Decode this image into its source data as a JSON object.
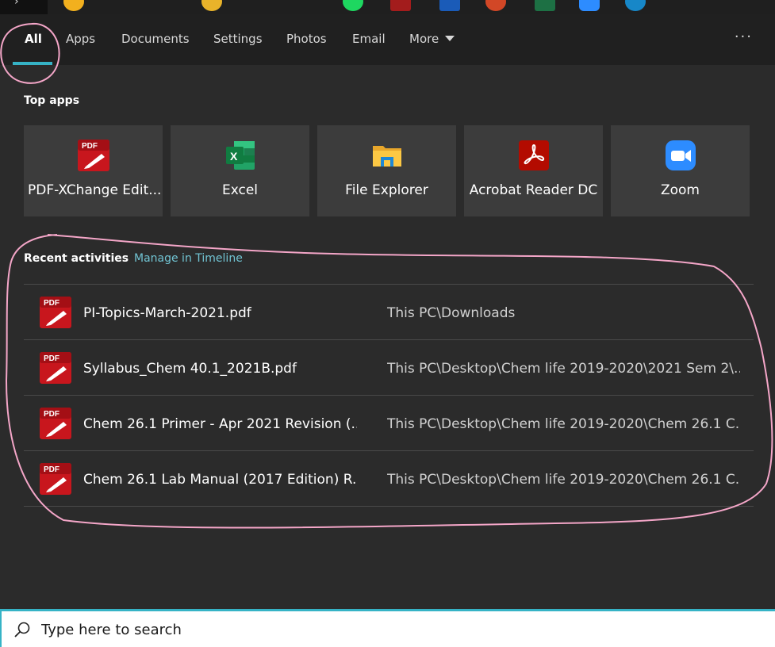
{
  "tabs": [
    {
      "label": "All",
      "active": true
    },
    {
      "label": "Apps"
    },
    {
      "label": "Documents"
    },
    {
      "label": "Settings"
    },
    {
      "label": "Photos"
    },
    {
      "label": "Email"
    },
    {
      "label": "More"
    }
  ],
  "more_options_icon": "ellipsis-icon",
  "top_apps": {
    "title": "Top apps",
    "items": [
      {
        "label": "PDF-XChange Edit...",
        "icon": "pdf-xchange-icon"
      },
      {
        "label": "Excel",
        "icon": "excel-icon"
      },
      {
        "label": "File Explorer",
        "icon": "file-explorer-icon"
      },
      {
        "label": "Acrobat Reader DC",
        "icon": "acrobat-icon"
      },
      {
        "label": "Zoom",
        "icon": "zoom-icon"
      }
    ]
  },
  "recent": {
    "title": "Recent activities",
    "timeline_link": "Manage in Timeline",
    "items": [
      {
        "name": "PI-Topics-March-2021.pdf",
        "path": "This PC\\Downloads"
      },
      {
        "name": "Syllabus_Chem 40.1_2021B.pdf",
        "path": "This PC\\Desktop\\Chem life 2019-2020\\2021 Sem 2\\..."
      },
      {
        "name": "Chem 26.1 Primer - Apr 2021 Revision (...",
        "path": "This PC\\Desktop\\Chem life 2019-2020\\Chem 26.1 C..."
      },
      {
        "name": "Chem 26.1 Lab Manual (2017 Edition) R...",
        "path": "This PC\\Desktop\\Chem life 2019-2020\\Chem 26.1 C..."
      }
    ]
  },
  "search": {
    "placeholder": "Type here to search"
  },
  "colors": {
    "accent": "#36b3c6",
    "link": "#71c4d3",
    "annotation": "#f4a6c8",
    "pdf_red": "#c8161d"
  }
}
